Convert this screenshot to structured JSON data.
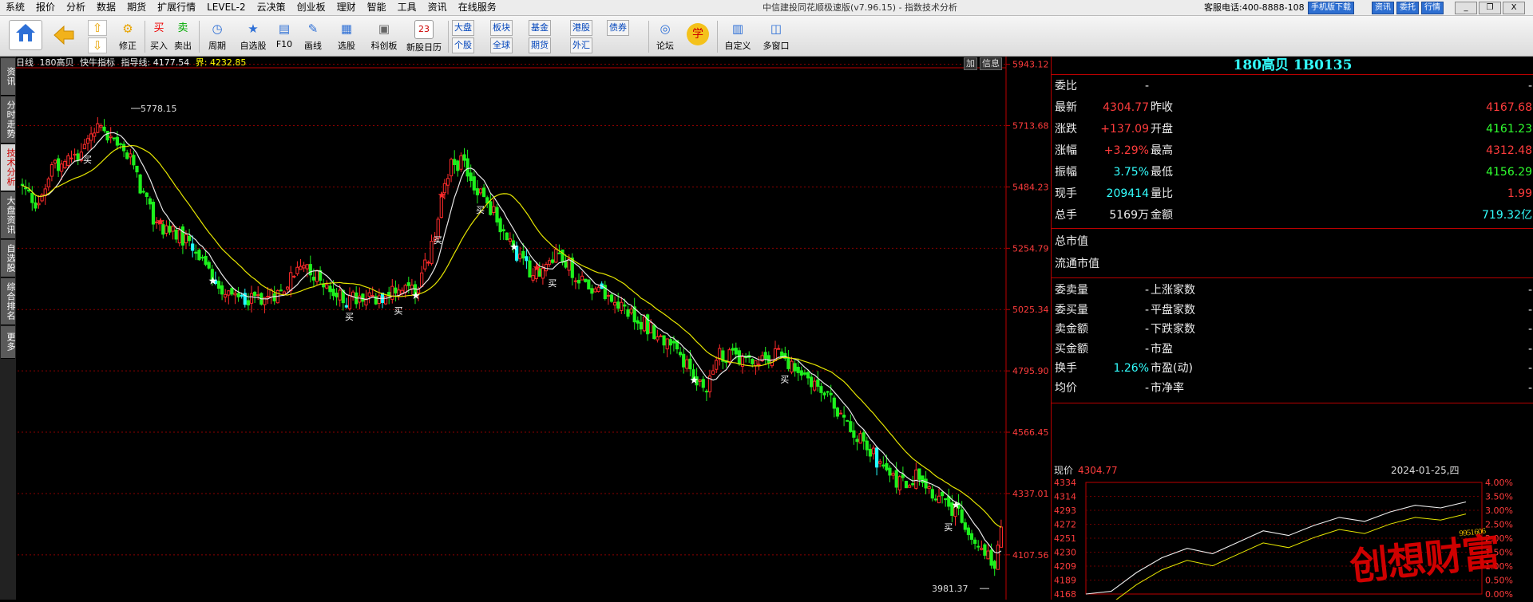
{
  "menu": [
    "系统",
    "报价",
    "分析",
    "数据",
    "期货",
    "扩展行情",
    "LEVEL-2",
    "云决策",
    "创业板",
    "理财",
    "智能",
    "工具",
    "资讯",
    "在线服务"
  ],
  "window_title": "中信建投同花顺极速版(v7.96.15) - 指数技术分析",
  "hotline": "客服电话:400-8888-108",
  "top_buttons": [
    "手机版下载",
    "资讯",
    "委托",
    "行情"
  ],
  "win_controls": [
    "_",
    "❐",
    "X"
  ],
  "toolbar": {
    "home": "",
    "back": "",
    "fix": "修正",
    "buy": "买入",
    "buy_icon": "买",
    "sell": "卖出",
    "sell_icon": "卖",
    "period": "周期",
    "selfselect": "自选股",
    "f10": "F10",
    "draw": "画线",
    "pick": "选股",
    "kcb": "科创板",
    "ipo": "新股日历",
    "ipo_date": "23",
    "market_row1": [
      "大盘",
      "板块",
      "基金",
      "港股",
      "债券"
    ],
    "market_row2": [
      "个股",
      "全球",
      "期货",
      "外汇"
    ],
    "forum": "论坛",
    "learn": "学",
    "custom": "自定义",
    "multiwin": "多窗口"
  },
  "left_tabs": [
    "资讯",
    "分时走势",
    "技术分析",
    "大盘资讯",
    "自选股",
    "综合排名",
    "更多"
  ],
  "chart": {
    "period": "日线",
    "name": "180高贝",
    "indicator": "快牛指标",
    "guide_label": "指导线:",
    "guide_value": "4177.54",
    "bound_label": "界:",
    "bound_value": "4232.85",
    "buttons": [
      "加",
      "信息"
    ],
    "high_mark": "5778.15",
    "low_mark": "3981.37",
    "buy_label": "买"
  },
  "chart_data": {
    "type": "candlestick",
    "ylim": [
      3940,
      5960
    ],
    "y_ticks": [
      "5943.12",
      "5713.68",
      "5484.23",
      "5254.79",
      "5025.34",
      "4795.90",
      "4566.45",
      "4337.01",
      "4107.56"
    ],
    "high": 5778.15,
    "low": 3981.37,
    "lines": [
      "指导线",
      "界"
    ]
  },
  "quote": {
    "title": "180高贝 1B0135",
    "rows": [
      {
        "k1": "委比",
        "v1": "-",
        "k2": "",
        "v2": "-"
      },
      {
        "k1": "最新",
        "v1": "4304.77",
        "k2": "昨收",
        "v2": "4167.68"
      },
      {
        "k1": "涨跌",
        "v1": "+137.09",
        "k2": "开盘",
        "v2": "4161.23"
      },
      {
        "k1": "涨幅",
        "v1": "+3.29%",
        "k2": "最高",
        "v2": "4312.48"
      },
      {
        "k1": "振幅",
        "v1": "3.75%",
        "k2": "最低",
        "v2": "4156.29"
      },
      {
        "k1": "现手",
        "v1": "209414",
        "k2": "量比",
        "v2": "1.99"
      },
      {
        "k1": "总手",
        "v1": "5169万",
        "k2": "金额",
        "v2": "719.32亿"
      }
    ],
    "mkt_total": "总市值",
    "mkt_float": "流通市值",
    "rows2": [
      {
        "k1": "委卖量",
        "v1": "-",
        "k2": "上涨家数",
        "v2": "-"
      },
      {
        "k1": "委买量",
        "v1": "-",
        "k2": "平盘家数",
        "v2": "-"
      },
      {
        "k1": "卖金额",
        "v1": "-",
        "k2": "下跌家数",
        "v2": "-"
      },
      {
        "k1": "买金额",
        "v1": "-",
        "k2": "市盈",
        "v2": "-"
      },
      {
        "k1": "换手",
        "v1": "1.26%",
        "k2": "市盈(动)",
        "v2": "-"
      },
      {
        "k1": "均价",
        "v1": "-",
        "k2": "市净率",
        "v2": "-"
      }
    ]
  },
  "mini": {
    "label": "现价",
    "price": "4304.77",
    "date": "2024-01-25,四",
    "left_ticks": [
      "4334",
      "4314",
      "4293",
      "4272",
      "4251",
      "4230",
      "4209",
      "4189",
      "4168"
    ],
    "right_ticks": [
      "4.00%",
      "3.50%",
      "3.00%",
      "2.50%",
      "2.00%",
      "1.50%",
      "1.00%",
      "0.50%",
      "0.00%"
    ]
  },
  "watermark": "创想财富",
  "watermark_sub": "9951606"
}
